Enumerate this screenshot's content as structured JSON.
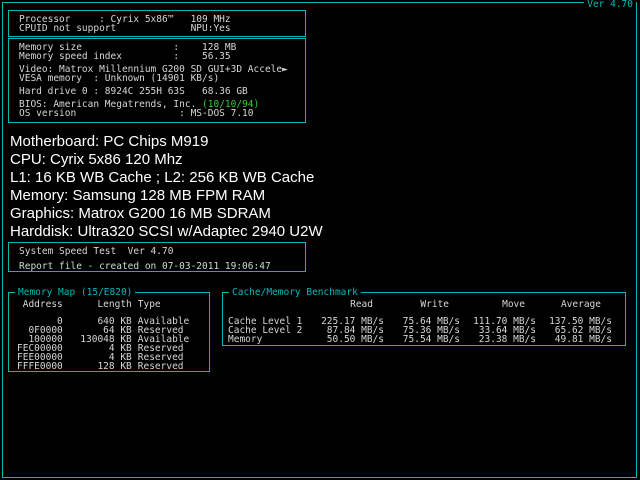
{
  "colors": {
    "cyan": "#00b9b9",
    "text": "#d6d6d6",
    "green": "#33cc33",
    "white": "#ffffff",
    "background": "#000000"
  },
  "version_label": "Ver 4.70",
  "processor_box": {
    "processor_line": "Processor     : Cyrix 5x86™   109 MHz",
    "cpuid_line": "CPUID not support             NPU:Yes"
  },
  "system_box": {
    "memory_size_line": "Memory size                :    128 MB",
    "memory_speed_line": "Memory speed index         :    56.35",
    "video_line": "Video: Matrox Millennium G200 SD GUI+3D Accele►",
    "vesa_line": "VESA memory  : Unknown (14901 KB/s)",
    "drive_line": "Hard drive 0 : 8924C 255H 63S   68.36 GB",
    "bios_prefix": "BIOS: American Megatrends, Inc. ",
    "bios_date": "(10/10/94)",
    "os_line": "OS version                  : MS-DOS 7.10"
  },
  "annotation": {
    "lines": [
      "Motherboard: PC Chips M919",
      "CPU: Cyrix 5x86 120 Mhz",
      "L1: 16 KB WB Cache ; L2: 256 KB WB Cache",
      "Memory: Samsung 128 MB FPM RAM",
      "Graphics: Matrox G200 16 MB SDRAM",
      "Harddisk: Ultra320 SCSI w/Adaptec 2940 U2W"
    ]
  },
  "report_box": {
    "title_line": "System Speed Test  Ver 4.70",
    "report_line": "Report file - created on 07-03-2011 19:06:47"
  },
  "memory_map": {
    "title": "Memory Map (15/E820)",
    "headers": [
      "Address",
      "Length",
      "Type"
    ],
    "rows": [
      [
        "0",
        "640 KB",
        "Available"
      ],
      [
        "0F0000",
        "64 KB",
        "Reserved"
      ],
      [
        "100000",
        "130048 KB",
        "Available"
      ],
      [
        "FEC00000",
        "4 KB",
        "Reserved"
      ],
      [
        "FEE00000",
        "4 KB",
        "Reserved"
      ],
      [
        "FFFE0000",
        "128 KB",
        "Reserved"
      ]
    ]
  },
  "benchmark": {
    "title": "Cache/Memory Benchmark",
    "headers": [
      "Read",
      "Write",
      "Move",
      "Average"
    ],
    "rows": [
      {
        "label": "Cache Level 1",
        "read": "225.17 MB/s",
        "write": "75.64 MB/s",
        "move": "111.70 MB/s",
        "average": "137.50 MB/s"
      },
      {
        "label": "Cache Level 2",
        "read": "87.84 MB/s",
        "write": "75.36 MB/s",
        "move": "33.64 MB/s",
        "average": "65.62 MB/s"
      },
      {
        "label": "Memory",
        "read": "50.50 MB/s",
        "write": "75.54 MB/s",
        "move": "23.38 MB/s",
        "average": "49.81 MB/s"
      }
    ]
  }
}
